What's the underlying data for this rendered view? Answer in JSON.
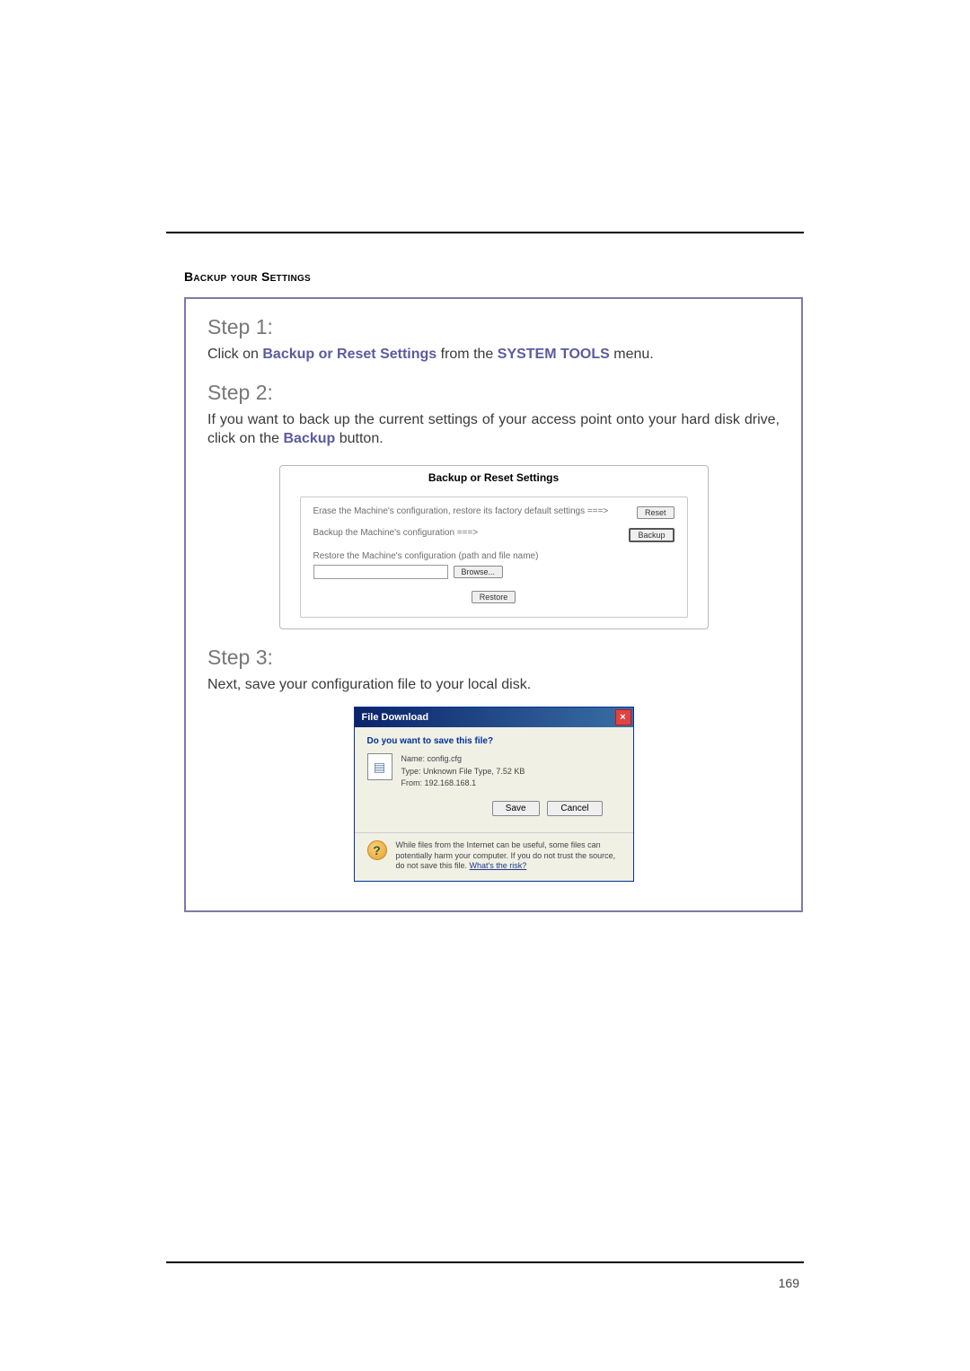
{
  "section_title": "Backup your Settings",
  "step1": {
    "heading": "Step 1:",
    "text_prefix": "Click on ",
    "bold1": "Backup or Reset Settings",
    "text_mid": " from the ",
    "bold2": "SYSTEM TOOLS",
    "text_suffix": " menu."
  },
  "step2": {
    "heading": "Step 2:",
    "text_prefix": "If you want to back up the current settings of your access point onto your hard disk drive, click on the ",
    "bold1": "Backup",
    "text_suffix": " button."
  },
  "backup_panel": {
    "title": "Backup or Reset Settings",
    "erase_text": "Erase the Machine's configuration, restore its factory default settings ===>",
    "reset_btn": "Reset",
    "backup_text": "Backup the Machine's configuration ===>",
    "backup_btn": "Backup",
    "restore_text": "Restore the Machine's configuration (path and file name)",
    "browse_btn": "Browse...",
    "restore_btn": "Restore"
  },
  "step3": {
    "heading": "Step 3:",
    "text": "Next, save your configuration file to your local disk."
  },
  "download_dialog": {
    "title": "File Download",
    "question": "Do you want to save this file?",
    "name_label": "Name:",
    "name_value": "config.cfg",
    "type_label": "Type:",
    "type_value": "Unknown File Type, 7.52 KB",
    "from_label": "From:",
    "from_value": "192.168.168.1",
    "save_btn": "Save",
    "cancel_btn": "Cancel",
    "warning_text": "While files from the Internet can be useful, some files can potentially harm your computer. If you do not trust the source, do not save this file. ",
    "risk_link": "What's the risk?"
  },
  "page_number": "169"
}
